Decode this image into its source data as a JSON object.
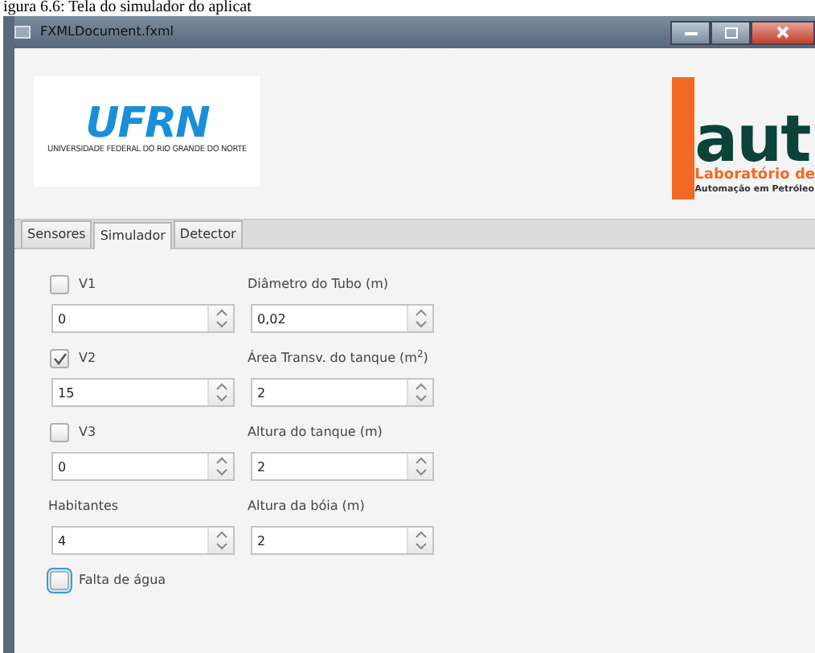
{
  "caption": "igura 6.6: Tela do simulador do aplicat",
  "window": {
    "title": "FXMLDocument.fxml"
  },
  "logos": {
    "left": {
      "text": "UFRN",
      "subtitle": "UNIVERSIDADE FEDERAL DO RIO GRANDE DO NORTE"
    },
    "right": {
      "text": "aut",
      "line1": "Laboratório de",
      "line2": "Automação em Petróleo"
    }
  },
  "tabs": [
    {
      "label": "Sensores",
      "selected": false
    },
    {
      "label": "Simulador",
      "selected": true
    },
    {
      "label": "Detector",
      "selected": false
    }
  ],
  "left_fields": [
    {
      "kind": "checkbox",
      "label": "V1",
      "checked": false,
      "value": "0"
    },
    {
      "kind": "checkbox",
      "label": "V2",
      "checked": true,
      "value": "15"
    },
    {
      "kind": "checkbox",
      "label": "V3",
      "checked": false,
      "value": "0"
    },
    {
      "kind": "label",
      "label": "Habitantes",
      "value": "4"
    }
  ],
  "right_fields": [
    {
      "label": "Diâmetro do Tubo (m)",
      "value": "0,02"
    },
    {
      "label": "Área Transv. do tanque (m$^{2}$)",
      "value": "2"
    },
    {
      "label": "Altura do tanque (m)",
      "value": "2"
    },
    {
      "label": "Altura da bóia (m)",
      "value": "2"
    }
  ],
  "bottom_checkbox": {
    "label": "Falta de água",
    "checked": false,
    "focused": true
  }
}
